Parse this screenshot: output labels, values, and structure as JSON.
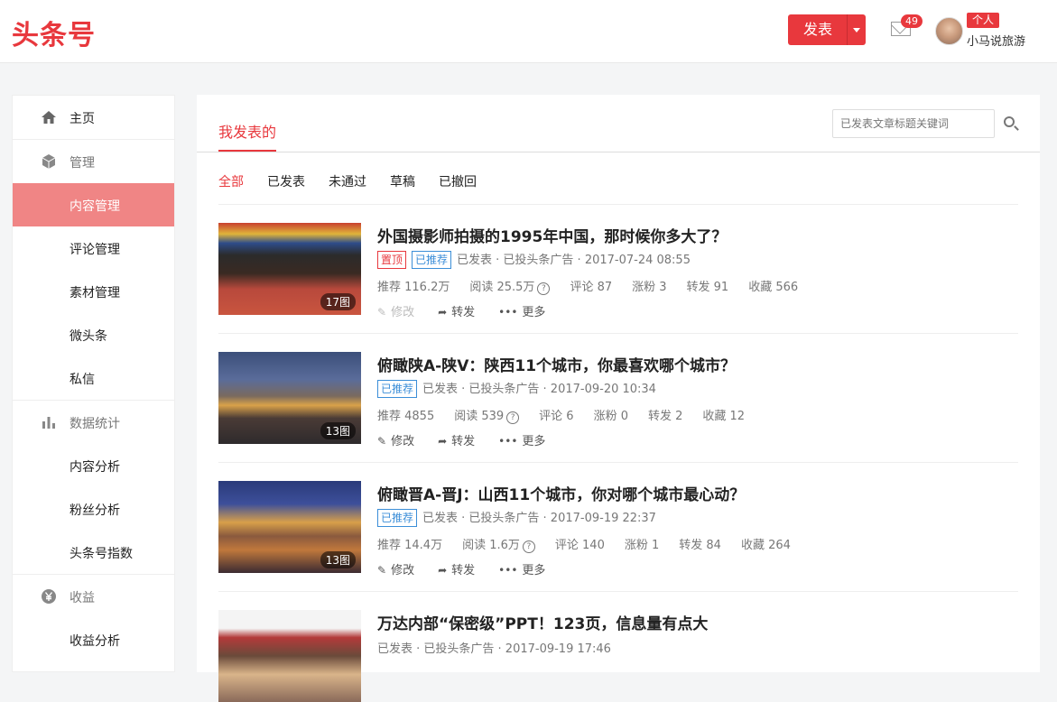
{
  "header": {
    "logo": "头条号",
    "publish_label": "发表",
    "mail_count": "49",
    "role_badge": "个人",
    "username": "小马说旅游"
  },
  "sidebar": {
    "items": [
      {
        "label": "主页",
        "icon": "home-icon"
      },
      {
        "label": "管理",
        "icon": "cube-icon"
      },
      {
        "label": "内容管理"
      },
      {
        "label": "评论管理"
      },
      {
        "label": "素材管理"
      },
      {
        "label": "微头条"
      },
      {
        "label": "私信"
      },
      {
        "label": "数据统计",
        "icon": "bar-chart-icon"
      },
      {
        "label": "内容分析"
      },
      {
        "label": "粉丝分析"
      },
      {
        "label": "头条号指数"
      },
      {
        "label": "收益",
        "icon": "yen-icon"
      },
      {
        "label": "收益分析"
      }
    ]
  },
  "main": {
    "tab": "我发表的",
    "search_placeholder": "已发表文章标题关键词",
    "filters": [
      "全部",
      "已发表",
      "未通过",
      "草稿",
      "已撤回"
    ],
    "articles": [
      {
        "title": "外国摄影师拍摄的1995年中国，那时候你多大了？",
        "tags": [
          "置顶",
          "已推荐"
        ],
        "status": "已发表 · 已投头条广告 · 2017-07-24 08:55",
        "image_count": "17图",
        "stats": {
          "recommend": "推荐 116.2万",
          "read": "阅读 25.5万",
          "comment": "评论 87",
          "fans": "涨粉 3",
          "share": "转发 91",
          "fav": "收藏 566"
        },
        "actions": [
          "修改",
          "转发",
          "更多"
        ]
      },
      {
        "title": "俯瞰陕A-陕V：陕西11个城市，你最喜欢哪个城市？",
        "tags": [
          "已推荐"
        ],
        "status": "已发表 · 已投头条广告 · 2017-09-20 10:34",
        "image_count": "13图",
        "stats": {
          "recommend": "推荐 4855",
          "read": "阅读 539",
          "comment": "评论 6",
          "fans": "涨粉 0",
          "share": "转发 2",
          "fav": "收藏 12"
        },
        "actions": [
          "修改",
          "转发",
          "更多"
        ]
      },
      {
        "title": "俯瞰晋A-晋J：山西11个城市，你对哪个城市最心动？",
        "tags": [
          "已推荐"
        ],
        "status": "已发表 · 已投头条广告 · 2017-09-19 22:37",
        "image_count": "13图",
        "stats": {
          "recommend": "推荐 14.4万",
          "read": "阅读 1.6万",
          "comment": "评论 140",
          "fans": "涨粉 1",
          "share": "转发 84",
          "fav": "收藏 264"
        },
        "actions": [
          "修改",
          "转发",
          "更多"
        ]
      },
      {
        "title": "万达内部“保密级”PPT！123页，信息量有点大",
        "status": "已发表 · 已投头条广告 · 2017-09-19 17:46"
      }
    ]
  },
  "colors": {
    "accent": "#e8383d",
    "sidebar_active": "#f08585",
    "tag_blue": "#3b8ed8"
  }
}
